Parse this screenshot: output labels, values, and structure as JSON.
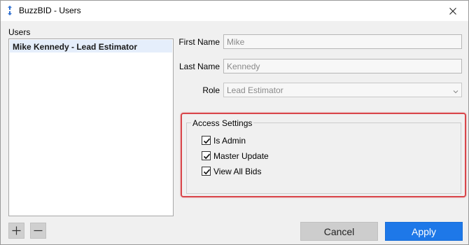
{
  "window": {
    "title": "BuzzBID - Users"
  },
  "users": {
    "label": "Users",
    "items": [
      "Mike Kennedy - Lead Estimator"
    ]
  },
  "form": {
    "first_name_label": "First Name",
    "first_name_value": "Mike",
    "last_name_label": "Last Name",
    "last_name_value": "Kennedy",
    "role_label": "Role",
    "role_value": "Lead Estimator"
  },
  "access_settings": {
    "title": "Access Settings",
    "options": [
      {
        "label": "Is Admin",
        "checked": true
      },
      {
        "label": "Master Update",
        "checked": true
      },
      {
        "label": "View All Bids",
        "checked": true
      }
    ]
  },
  "buttons": {
    "cancel": "Cancel",
    "apply": "Apply"
  },
  "colors": {
    "apply_blue": "#1e78e8",
    "highlight_red": "#d9464a",
    "selected_row": "#e5eefb"
  }
}
